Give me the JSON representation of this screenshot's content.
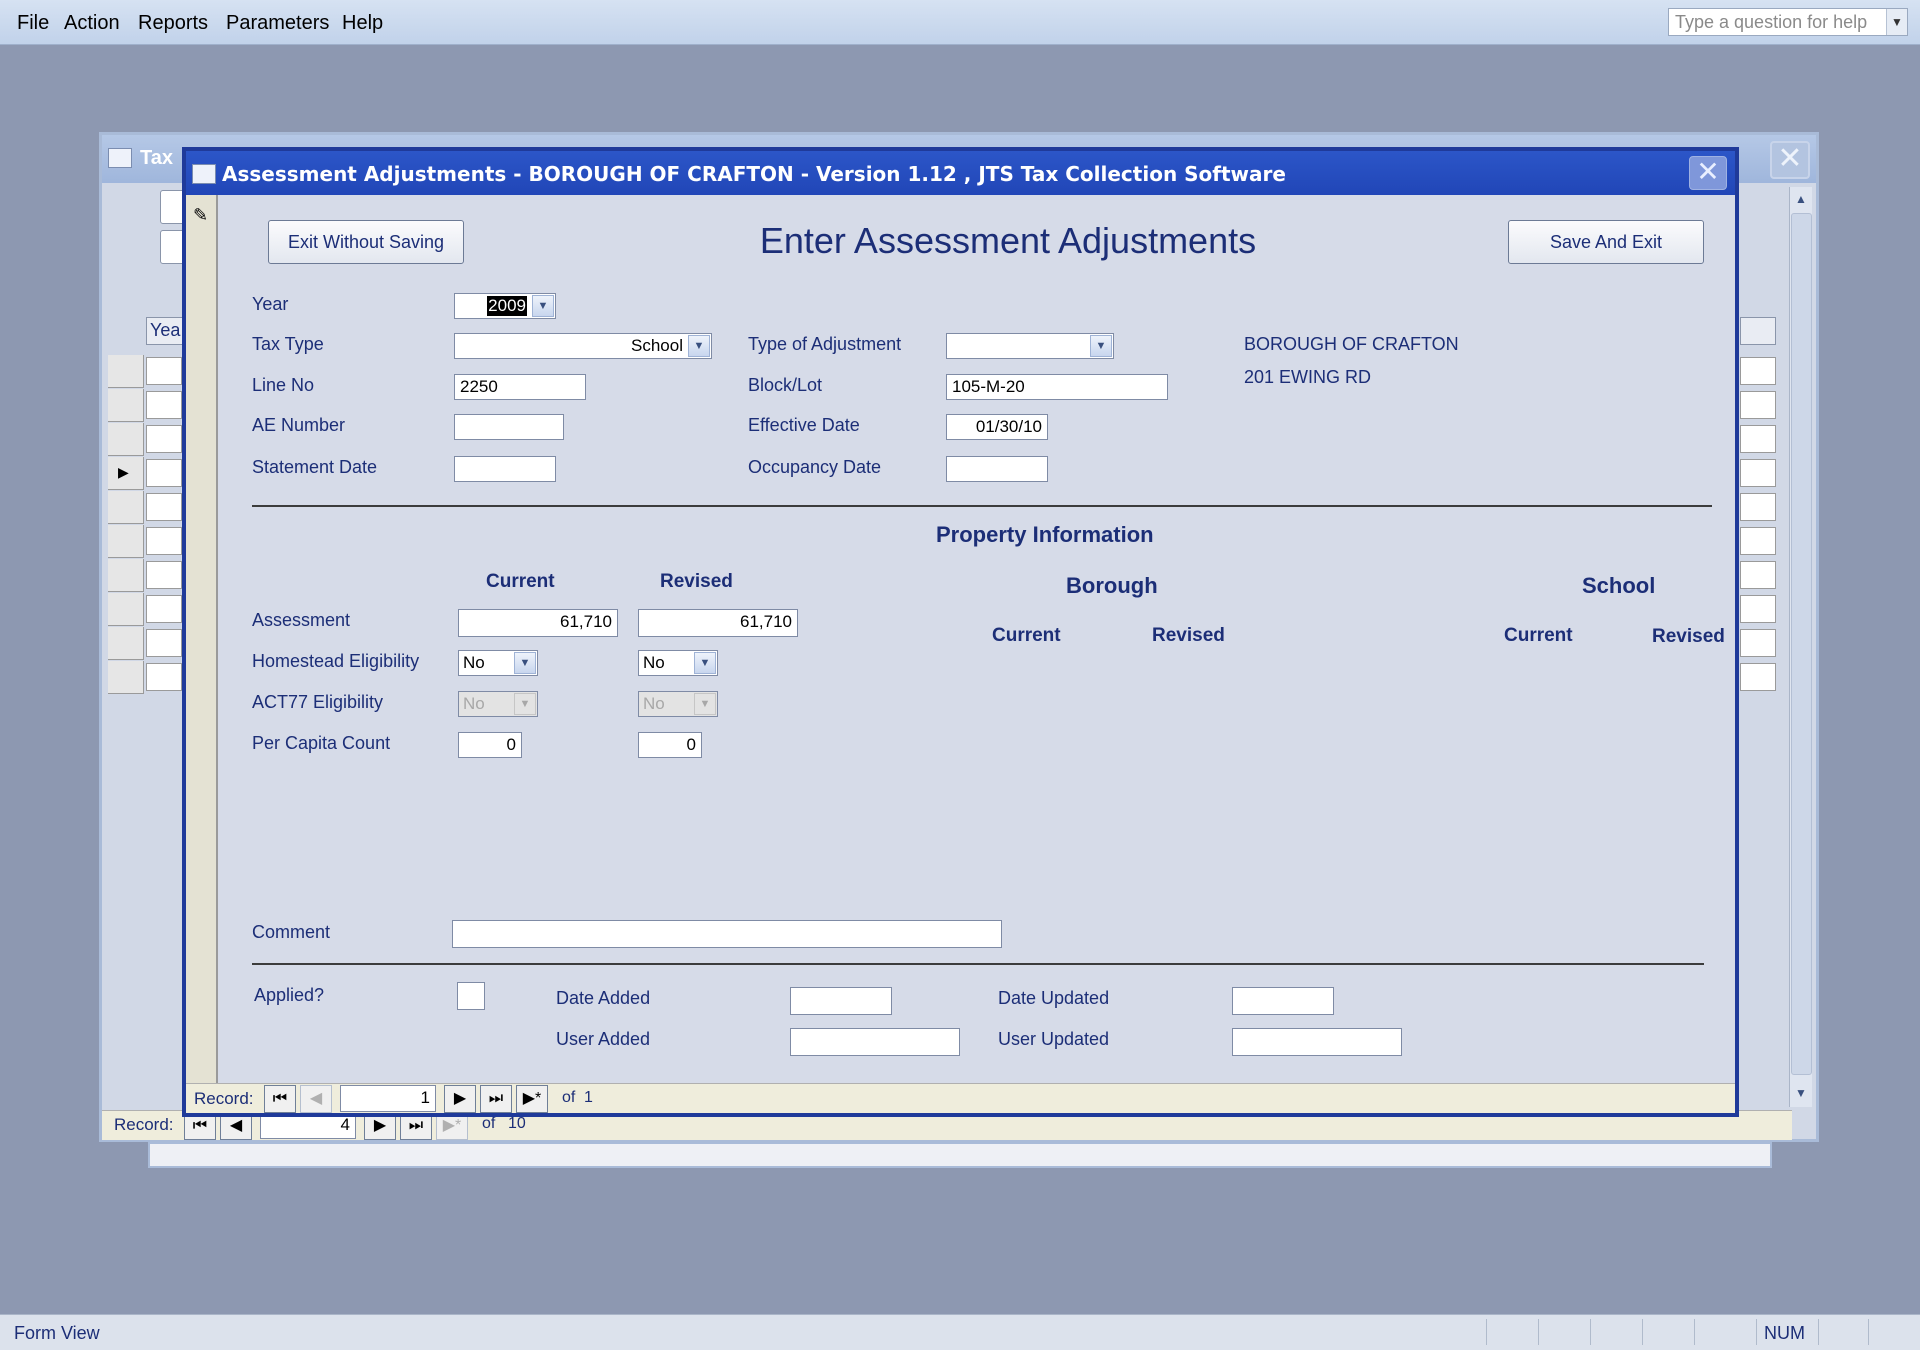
{
  "menu": [
    "File",
    "Action",
    "Reports",
    "Parameters",
    "Help"
  ],
  "help_placeholder": "Type a question for help",
  "status": {
    "left": "Form View",
    "num": "NUM"
  },
  "bg": {
    "title": "Tax",
    "col_header": "Yea",
    "record_label": "Record:",
    "record_value": "4",
    "of_label": "of",
    "total": "10"
  },
  "dialog": {
    "title": "Assessment Adjustments - BOROUGH OF CRAFTON - Version 1.12 ,  JTS Tax Collection Software",
    "heading": "Enter Assessment Adjustments",
    "exit_label": "Exit Without Saving",
    "save_label": "Save And Exit",
    "labels": {
      "year": "Year",
      "tax_type": "Tax Type",
      "line_no": "Line No",
      "ae_number": "AE Number",
      "statement_date": "Statement Date",
      "type_adj": "Type of Adjustment",
      "block_lot": "Block/Lot",
      "effective_date": "Effective Date",
      "occupancy_date": "Occupancy Date",
      "assessment": "Assessment",
      "homestead": "Homestead Eligibility",
      "act77": "ACT77 Eligibility",
      "per_capita": "Per Capita Count",
      "comment": "Comment",
      "applied": "Applied?",
      "date_added": "Date Added",
      "user_added": "User Added",
      "date_updated": "Date Updated",
      "user_updated": "User Updated"
    },
    "values": {
      "year": "2009",
      "tax_type": "School",
      "type_adj": "",
      "line_no": "2250",
      "block_lot": "105-M-20",
      "ae_number": "",
      "effective_date": "01/30/10",
      "statement_date": "",
      "occupancy_date": "",
      "assessment_current": "61,710",
      "assessment_revised": "61,710",
      "homestead_current": "No",
      "homestead_revised": "No",
      "act77_current": "No",
      "act77_revised": "No",
      "per_capita_current": "0",
      "per_capita_revised": "0",
      "comment": "",
      "date_added": "",
      "user_added": "",
      "date_updated": "",
      "user_updated": ""
    },
    "owner": {
      "name": "BOROUGH OF CRAFTON",
      "address": "201 EWING RD"
    },
    "property_info": "Property Information",
    "current": "Current",
    "revised": "Revised",
    "borough": "Borough",
    "school": "School",
    "record_label": "Record:",
    "record_value": "1",
    "of_label": "of",
    "total": "1"
  }
}
